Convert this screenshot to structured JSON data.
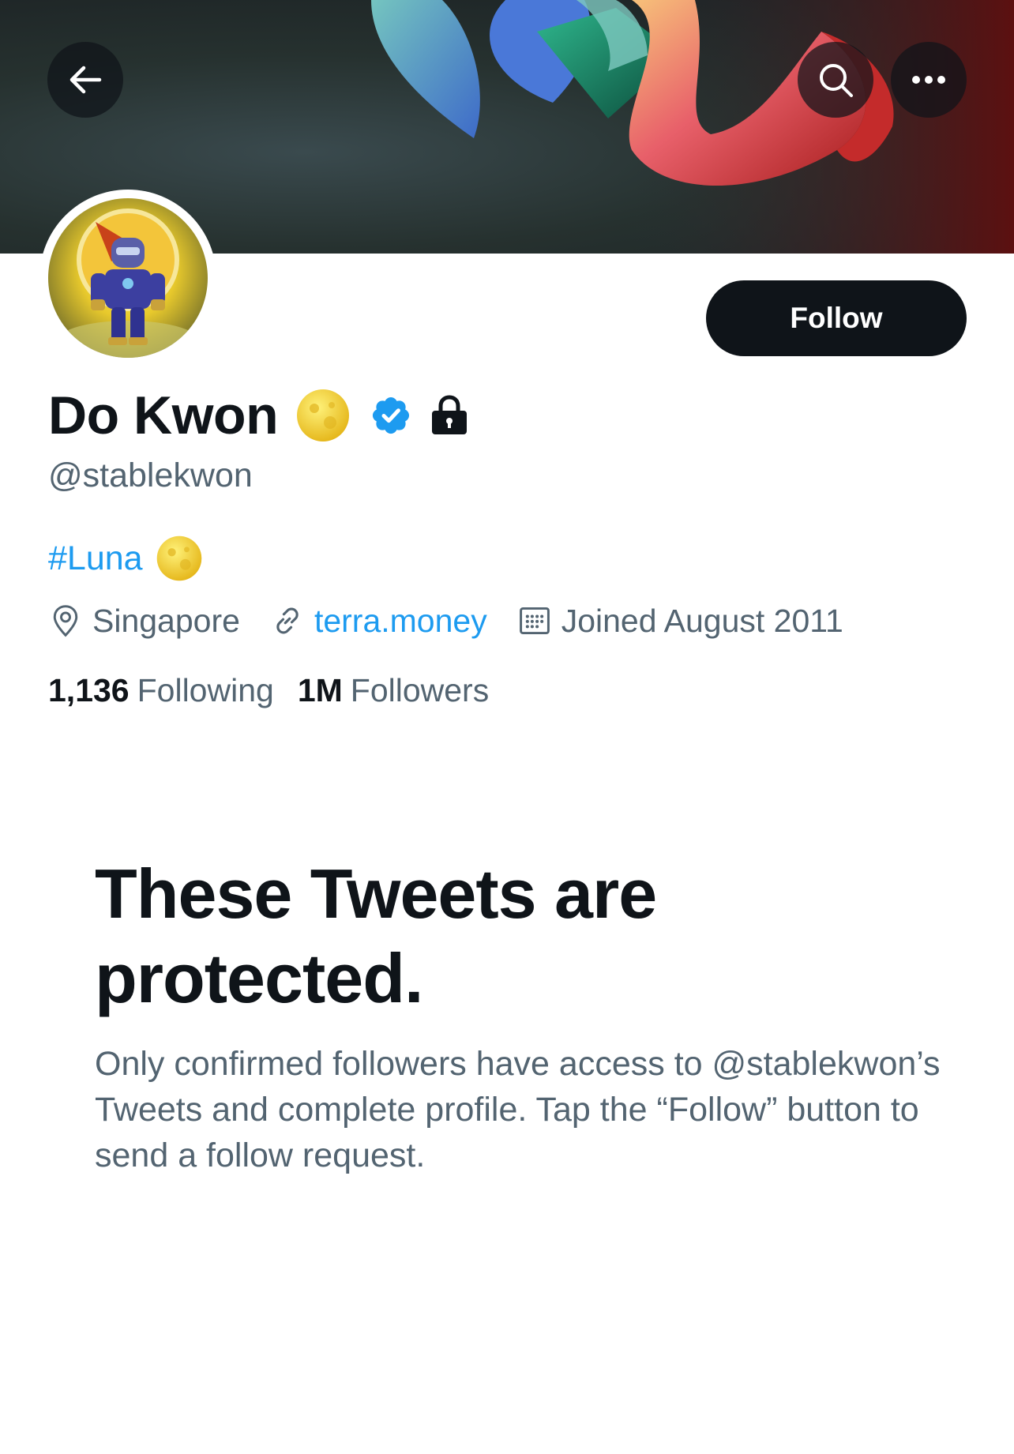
{
  "header": {
    "back_icon": "arrow-left-icon",
    "search_icon": "search-icon",
    "more_icon": "more-horizontal-icon"
  },
  "profile": {
    "display_name": "Do Kwon",
    "name_badges": [
      "moon-emoji-icon",
      "verified-badge-icon",
      "lock-icon"
    ],
    "handle": "@stablekwon",
    "bio_hashtag": "#Luna",
    "bio_emoji": "moon-emoji-icon",
    "location": "Singapore",
    "website": "terra.money",
    "joined": "Joined August 2011",
    "following_count": "1,136",
    "following_label": "Following",
    "followers_count": "1M",
    "followers_label": "Followers"
  },
  "actions": {
    "follow_label": "Follow"
  },
  "protected": {
    "title": "These Tweets are protected.",
    "body": "Only confirmed followers have access to @stablekwon’s Tweets and complete profile. Tap the “Follow” button to send a follow request."
  },
  "colors": {
    "link": "#1d9bf0",
    "text_primary": "#0f1419",
    "text_secondary": "#536471",
    "follow_button_bg": "#0f1419"
  }
}
